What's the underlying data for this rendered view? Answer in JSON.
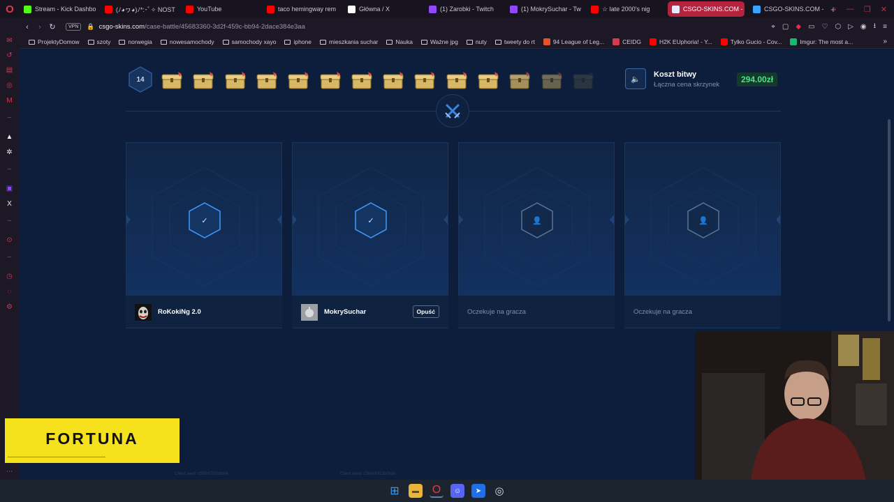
{
  "browser": {
    "tabs": [
      {
        "label": "Stream - Kick Dashbo",
        "color": "#53fc18",
        "active": false
      },
      {
        "label": "(ﾉ◕ヮ◕)ﾉ*:･ﾟ✧ NOST",
        "color": "#ff0000",
        "active": false
      },
      {
        "label": "YouTube",
        "color": "#ff0000",
        "active": false
      },
      {
        "label": "taco hemingway rem",
        "color": "#ff0000",
        "active": false
      },
      {
        "label": "Główna / X",
        "color": "#ffffff",
        "active": false
      },
      {
        "label": "(1) Zarobki - Twitch",
        "color": "#9146ff",
        "active": false
      },
      {
        "label": "(1) MokrySuchar - Tw",
        "color": "#9146ff",
        "active": false
      },
      {
        "label": "☆ late 2000's nig",
        "color": "#ff0000",
        "active": false
      },
      {
        "label": "CSGO-SKINS.COM - Naj",
        "color": "#e8e8ff",
        "active": true
      },
      {
        "label": "CSGO-SKINS.COM -",
        "color": "#3aa3ff",
        "active": false
      }
    ],
    "url_host": "csgo-skins.com",
    "url_path": "/case-battle/45683360-3d2f-459c-bb94-2dace384e3aa",
    "vpn_label": "VPN",
    "bookmarks": [
      {
        "label": "ProjektyDomow",
        "type": "folder"
      },
      {
        "label": "szoty",
        "type": "folder"
      },
      {
        "label": "norwegia",
        "type": "folder"
      },
      {
        "label": "nowesamochody",
        "type": "folder"
      },
      {
        "label": "samochody xayo",
        "type": "folder"
      },
      {
        "label": "iphone",
        "type": "folder"
      },
      {
        "label": "mieszkania suchar",
        "type": "folder"
      },
      {
        "label": "Nauka",
        "type": "folder"
      },
      {
        "label": "Ważne jpg",
        "type": "folder"
      },
      {
        "label": "nuty",
        "type": "folder"
      },
      {
        "label": "tweety do rt",
        "type": "folder"
      },
      {
        "label": "94 League of Leg...",
        "type": "site",
        "color": "#e5532d"
      },
      {
        "label": "CEIDG",
        "type": "site",
        "color": "#d8394c"
      },
      {
        "label": "H2K EUphoria! - Y...",
        "type": "site",
        "color": "#ff0000"
      },
      {
        "label": "Tylko Gucio - Cov...",
        "type": "site",
        "color": "#ff0000"
      },
      {
        "label": "Imgur: The most a...",
        "type": "site",
        "color": "#1bb76e"
      }
    ]
  },
  "battle": {
    "round_count": "14",
    "case_count": 14,
    "cost_title": "Koszt bitwy",
    "cost_subtitle": "Łączna cena skrzynek",
    "cost_value": "294.00zł",
    "players": [
      {
        "name": "RoKokiNg 2.0",
        "status": "ready",
        "avatar": "joker"
      },
      {
        "name": "MokrySuchar",
        "status": "ready",
        "avatar": "apple",
        "action": "Opuść"
      },
      {
        "name": "",
        "status": "waiting",
        "waiting_text": "Oczekuje na gracza"
      },
      {
        "name": "",
        "status": "waiting",
        "waiting_text": "Oczekuje na gracza"
      }
    ],
    "client_seeds": [
      "Client seed: c5f8b97b3b6bf4",
      "Client seed: c5b0ef0f23b0bde"
    ]
  },
  "ad": {
    "brand": "FORTUNA",
    "color": "#f5e21c"
  },
  "colors": {
    "accent_blue": "#3a86e0",
    "price_green": "#47e38a",
    "page_bg": "#0c1e3b"
  }
}
